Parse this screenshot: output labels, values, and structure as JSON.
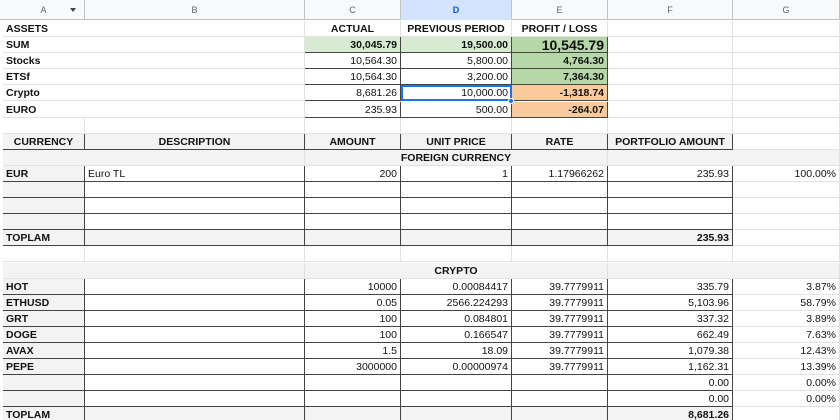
{
  "columns": [
    "A",
    "B",
    "C",
    "D",
    "E",
    "F",
    "G"
  ],
  "summary": {
    "header": [
      "ASSETS",
      "",
      "ACTUAL",
      "PREVIOUS PERIOD",
      "PROFIT / LOSS"
    ],
    "rows": [
      {
        "label": "SUM",
        "actual": "30,045.79",
        "previous": "19,500.00",
        "pl": "10,545.79"
      },
      {
        "label": "Stocks",
        "actual": "10,564.30",
        "previous": "5,800.00",
        "pl": "4,764.30"
      },
      {
        "label": "ETSf",
        "actual": "10,564.30",
        "previous": "3,200.00",
        "pl": "7,364.30"
      },
      {
        "label": "Crypto",
        "actual": "8,681.26",
        "previous": "10,000.00",
        "pl": "-1,318.74"
      },
      {
        "label": "EURO",
        "actual": "235.93",
        "previous": "500.00",
        "pl": "-264.07"
      }
    ]
  },
  "table_header": [
    "CURRENCY",
    "DESCRIPTION",
    "AMOUNT",
    "UNIT PRICE",
    "RATE",
    "PORTFOLIO AMOUNT"
  ],
  "foreign": {
    "title": "FOREIGN CURRENCY",
    "rows": [
      {
        "currency": "EUR",
        "description": "Euro TL",
        "amount": "200",
        "unit_price": "1",
        "rate": "1.17966262",
        "portfolio": "235.93",
        "pct": "100.00%"
      }
    ],
    "total_label": "TOPLAM",
    "total": "235.93"
  },
  "crypto": {
    "title": "CRYPTO",
    "rows": [
      {
        "currency": "HOT",
        "amount": "10000",
        "unit_price": "0.00084417",
        "rate": "39.7779911",
        "portfolio": "335.79",
        "pct": "3.87%"
      },
      {
        "currency": "ETHUSD",
        "amount": "0.05",
        "unit_price": "2566.224293",
        "rate": "39.7779911",
        "portfolio": "5,103.96",
        "pct": "58.79%"
      },
      {
        "currency": "GRT",
        "amount": "100",
        "unit_price": "0.084801",
        "rate": "39.7779911",
        "portfolio": "337.32",
        "pct": "3.89%"
      },
      {
        "currency": "DOGE",
        "amount": "100",
        "unit_price": "0.166547",
        "rate": "39.7779911",
        "portfolio": "662.49",
        "pct": "7.63%"
      },
      {
        "currency": "AVAX",
        "amount": "1.5",
        "unit_price": "18.09",
        "rate": "39.7779911",
        "portfolio": "1,079.38",
        "pct": "12.43%"
      },
      {
        "currency": "PEPE",
        "amount": "3000000",
        "unit_price": "0.00000974",
        "rate": "39.7779911",
        "portfolio": "1,162.31",
        "pct": "13.39%"
      },
      {
        "currency": "",
        "amount": "",
        "unit_price": "",
        "rate": "",
        "portfolio": "0.00",
        "pct": "0.00%"
      },
      {
        "currency": "",
        "amount": "",
        "unit_price": "",
        "rate": "",
        "portfolio": "0.00",
        "pct": "0.00%"
      }
    ],
    "total_label": "TOPLAM",
    "total": "8,681.26"
  }
}
